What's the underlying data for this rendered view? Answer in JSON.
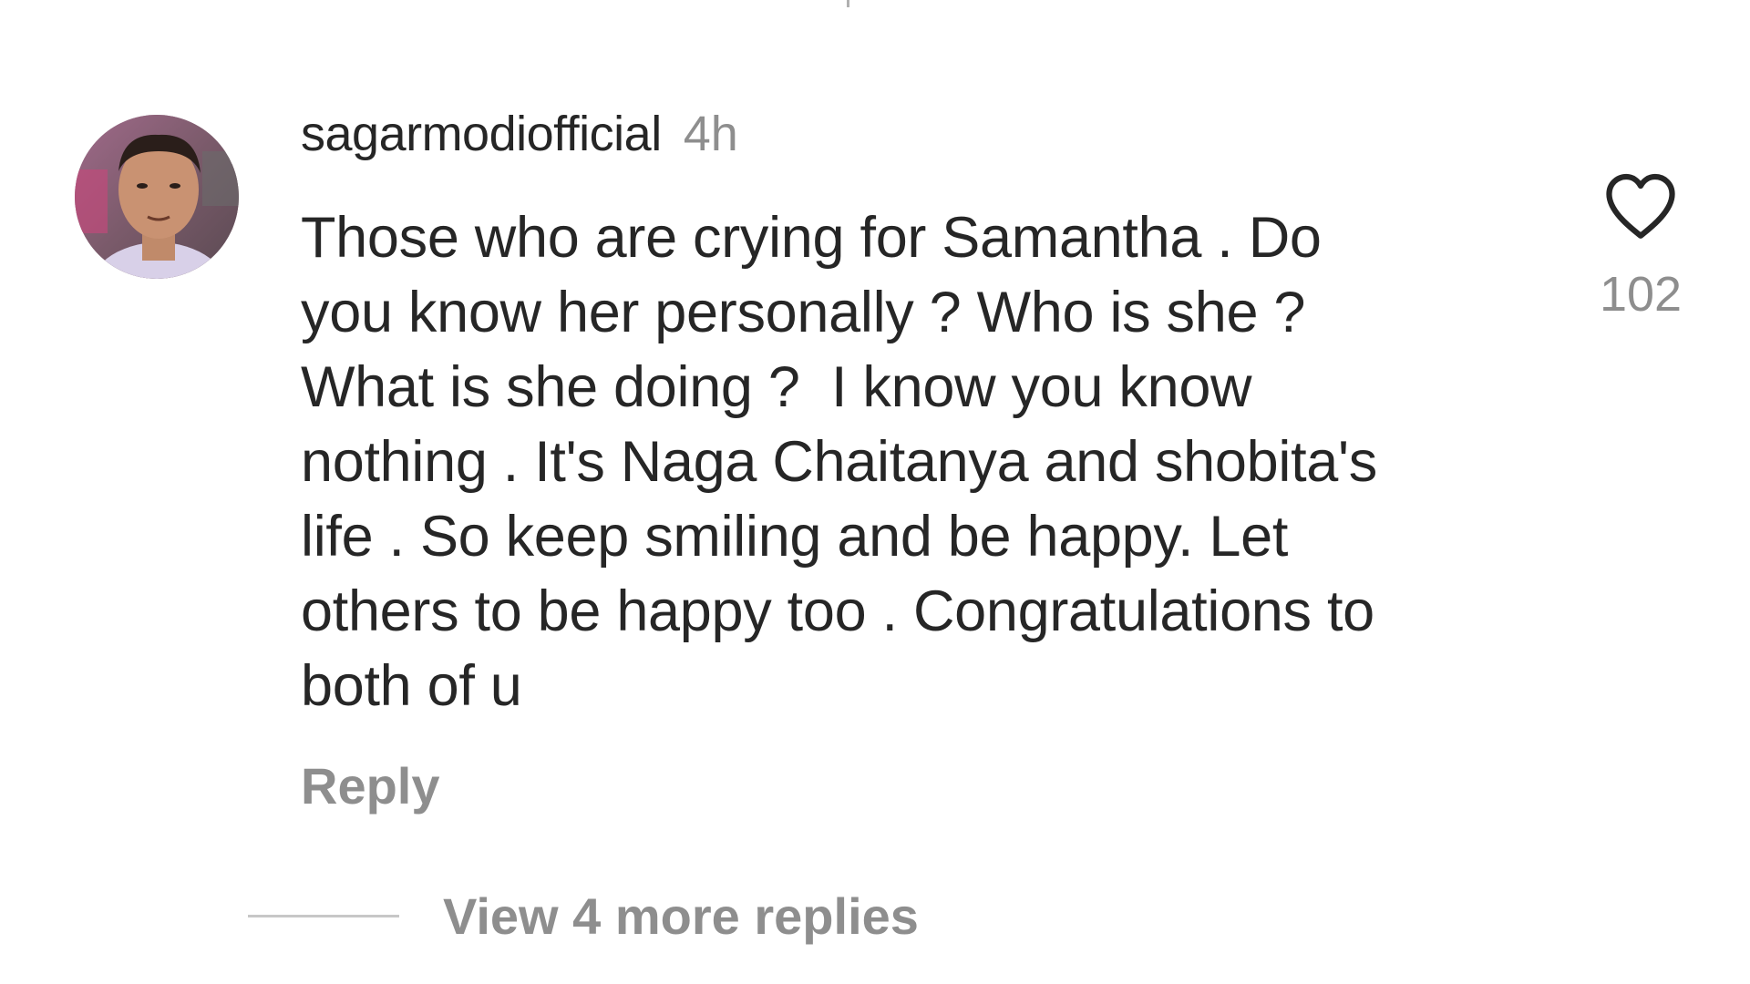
{
  "comment": {
    "username": "sagarmodiofficial",
    "timestamp": "4h",
    "lines": [
      "Those who are crying for Samantha . Do",
      "you know her personally ? Who is she ?",
      "What is she doing ?  I know you know",
      "nothing . It's Naga Chaitanya and shobita's",
      "life . So keep smiling and be happy. Let",
      "others to be happy too . Congratulations to",
      "both of u"
    ],
    "like_count": "102",
    "reply_label": "Reply",
    "view_replies_label": "View 4 more replies",
    "avatar_icon": "user-avatar",
    "like_icon": "heart-outline-icon"
  },
  "colors": {
    "text_primary": "#262626",
    "text_secondary": "#8e8e8e",
    "divider": "#c7c7c7",
    "background": "#ffffff"
  }
}
